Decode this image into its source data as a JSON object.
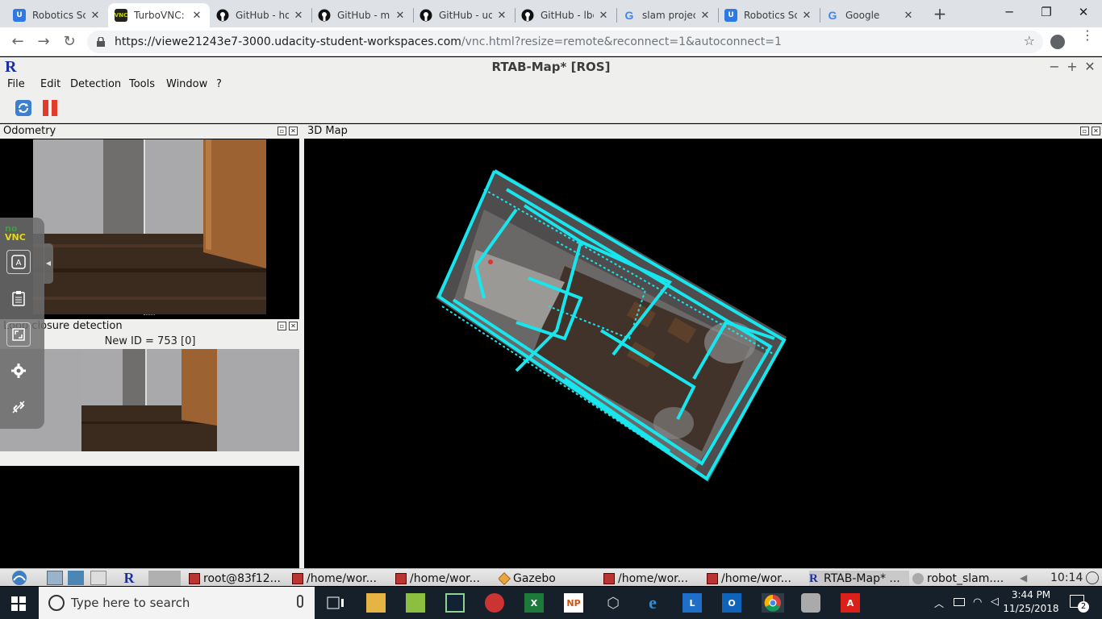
{
  "browser": {
    "tabs": [
      {
        "title": "Robotics Sc",
        "icon": "udacity-icon",
        "color": "#2d79e6",
        "active": false
      },
      {
        "title": "TurboVNC:",
        "icon": "vnc-icon",
        "color": "#222222",
        "active": true
      },
      {
        "title": "GitHub - ho",
        "icon": "github-icon",
        "color": "#111111",
        "active": false
      },
      {
        "title": "GitHub - m",
        "icon": "github-icon",
        "color": "#111111",
        "active": false
      },
      {
        "title": "GitHub - ud",
        "icon": "github-icon",
        "color": "#111111",
        "active": false
      },
      {
        "title": "GitHub - lbe",
        "icon": "github-icon",
        "color": "#111111",
        "active": false
      },
      {
        "title": "slam projec",
        "icon": "google-icon",
        "color": "#4285f4",
        "active": false
      },
      {
        "title": "Robotics Sc",
        "icon": "udacity-icon",
        "color": "#2d79e6",
        "active": false
      },
      {
        "title": "Google",
        "icon": "google-icon",
        "color": "#4285f4",
        "active": false
      }
    ],
    "new_tab": "+",
    "url_host": "https://viewe21243e7-3000.udacity-student-workspaces.com",
    "url_path": "/vnc.html?resize=remote&reconnect=1&autoconnect=1"
  },
  "rtab": {
    "logo": "R",
    "title": "RTAB-Map* [ROS]",
    "menus": [
      "File",
      "Edit",
      "Detection",
      "Tools",
      "Window",
      "?"
    ],
    "odometry_label": "Odometry",
    "map_label": "3D Map",
    "loop_label": "Loop closure detection",
    "new_id": "New ID = 753 [0]"
  },
  "novnc": {
    "logo_top": "no",
    "logo_bottom": "VNC"
  },
  "linux_taskbar": {
    "items": [
      "root@83f12...",
      "/home/wor...",
      "/home/wor...",
      "Gazebo",
      "/home/wor...",
      "/home/wor...",
      "RTAB-Map* ...",
      "robot_slam...."
    ],
    "time": "10:14"
  },
  "windows_taskbar": {
    "search_placeholder": "Type here to search",
    "time": "3:44 PM",
    "date": "11/25/2018",
    "notifications": "2"
  },
  "colors": {
    "map_lines": "#18e6ee",
    "rtab_blue": "#1a2ea8"
  }
}
